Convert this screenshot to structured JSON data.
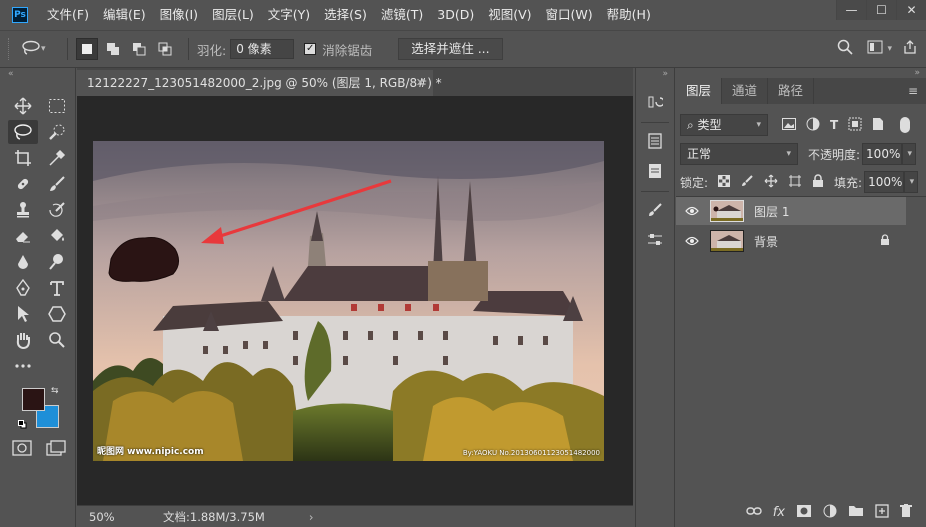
{
  "app": {
    "logo": "Ps"
  },
  "menu": [
    "文件(F)",
    "编辑(E)",
    "图像(I)",
    "图层(L)",
    "文字(Y)",
    "选择(S)",
    "滤镜(T)",
    "3D(D)",
    "视图(V)",
    "窗口(W)",
    "帮助(H)"
  ],
  "window_controls": {
    "minimize": "—",
    "restore": "☐",
    "close": "✕"
  },
  "options": {
    "feather_label": "羽化:",
    "feather_value": "0 像素",
    "antialias_label": "消除锯齿",
    "antialias_checked": "✓",
    "select_mask_label": "选择并遮住 ..."
  },
  "document": {
    "tab_title": "12122227_123051482000_2.jpg @ 50% (图层 1, RGB/8#) *",
    "tab_close": "✕",
    "zoom": "50%",
    "doc_size": "文档:1.88M/3.75M",
    "status_arrow": "›",
    "watermark_left": "昵图网 www.nipic.com",
    "watermark_right": "By:YAOKU  No.20130601123051482000"
  },
  "layers_panel": {
    "tabs": [
      "图层",
      "通道",
      "路径"
    ],
    "filter_kind": "⌕ 类型",
    "blend_mode": "正常",
    "opacity_label": "不透明度:",
    "opacity_value": "100%",
    "lock_label": "锁定:",
    "fill_label": "填充:",
    "fill_value": "100%",
    "layers": [
      {
        "name": "图层 1",
        "visible": true,
        "selected": true,
        "locked": false
      },
      {
        "name": "背景",
        "visible": true,
        "selected": false,
        "locked": true
      }
    ]
  },
  "colors": {
    "foreground": "#2a1414",
    "background": "#1e8fd8",
    "accent": "#31a8ff",
    "arrow": "#e8393c"
  }
}
